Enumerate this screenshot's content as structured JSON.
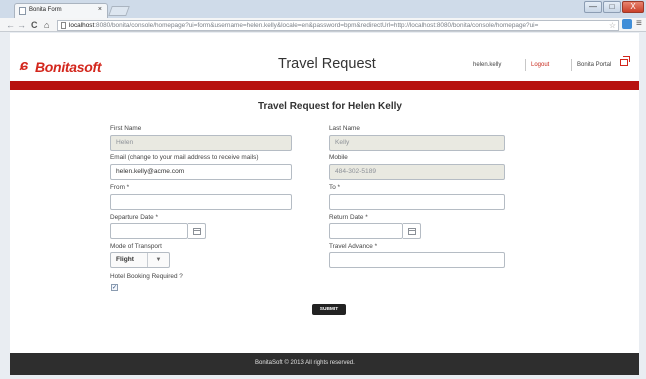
{
  "browser": {
    "tab_title": "Bonita Form",
    "tab_close": "×",
    "window_controls": {
      "minimize": "—",
      "maximize": "□",
      "close": "X"
    },
    "nav": {
      "back": "←",
      "forward": "→",
      "reload": "C",
      "home": "⌂"
    },
    "url_host": "localhost",
    "url_rest": ":8080/bonita/console/homepage?ui=form&username=helen.kelly&locale=en&password=bpm&redirectUrl=http://localhost:8080/bonita/console/homepage?ui=",
    "bookmark_star": "☆",
    "menu_icon": "≡"
  },
  "header": {
    "logo_icon": "ɕ",
    "logo_text": "Bonitasoft",
    "title": "Travel Request",
    "user": "helen.kelly",
    "logout": "Logout",
    "portal": "Bonita Portal"
  },
  "form": {
    "title": "Travel Request for Helen Kelly",
    "first_name": {
      "label": "First Name",
      "value": "Helen"
    },
    "last_name": {
      "label": "Last Name",
      "value": "Kelly"
    },
    "email": {
      "label": "Email (change to your mail address to receive mails)",
      "value": "helen.kelly@acme.com"
    },
    "mobile": {
      "label": "Mobile",
      "value": "484-302-5189"
    },
    "from": {
      "label": "From *",
      "value": ""
    },
    "to": {
      "label": "To *",
      "value": ""
    },
    "departure_date": {
      "label": "Departure Date *",
      "value": ""
    },
    "return_date": {
      "label": "Return Date *",
      "value": ""
    },
    "mode_of_transport": {
      "label": "Mode of Transport",
      "value": "Flight",
      "arrow": "▼"
    },
    "travel_advance": {
      "label": "Travel Advance *",
      "value": ""
    },
    "hotel_booking": {
      "label": "Hotel Booking Required ?",
      "checked_mark": "✓",
      "checked": true
    },
    "submit": "SUBMIT"
  },
  "footer": {
    "text": "BonitaSoft © 2013 All rights reserved."
  },
  "colors": {
    "brand_red": "#d3261c",
    "header_bar": "#b7120f",
    "footer": "#2e2e2e"
  }
}
